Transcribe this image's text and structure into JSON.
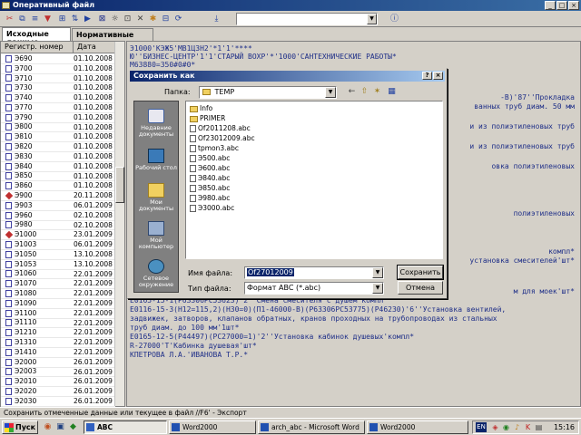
{
  "window": {
    "title": "Оперативный файл"
  },
  "toolbar": {
    "icons": [
      "scissors-icon",
      "copy-icon",
      "equals-icon",
      "filter-icon",
      "insert-icon",
      "sort-icon",
      "play-icon",
      "close-doc-icon",
      "bug-icon",
      "cut-icon",
      "x-icon",
      "star-icon",
      "db-icon",
      "refresh-icon",
      "fetch-icon",
      "info-icon"
    ],
    "combo_value": ""
  },
  "tabs": [
    {
      "label": "Исходные данные",
      "active": true
    },
    {
      "label": "Нормативные данные",
      "active": false
    }
  ],
  "list": {
    "col_reg": "Регистр. номер",
    "col_date": "Дата",
    "rows": [
      {
        "reg": "Э690",
        "date": "01.10.2008"
      },
      {
        "reg": "Э700",
        "date": "01.10.2008"
      },
      {
        "reg": "Э710",
        "date": "01.10.2008"
      },
      {
        "reg": "Э730",
        "date": "01.10.2008"
      },
      {
        "reg": "Э740",
        "date": "01.10.2008"
      },
      {
        "reg": "Э770",
        "date": "01.10.2008"
      },
      {
        "reg": "Э790",
        "date": "01.10.2008"
      },
      {
        "reg": "Э800",
        "date": "01.10.2008"
      },
      {
        "reg": "Э810",
        "date": "01.10.2008"
      },
      {
        "reg": "Э820",
        "date": "01.10.2008"
      },
      {
        "reg": "Э830",
        "date": "01.10.2008"
      },
      {
        "reg": "Э840",
        "date": "01.10.2008"
      },
      {
        "reg": "Э850",
        "date": "01.10.2008"
      },
      {
        "reg": "Э860",
        "date": "01.10.2008"
      },
      {
        "reg": "Э900",
        "date": "20.11.2008",
        "mark": true
      },
      {
        "reg": "Э903",
        "date": "06.01.2009"
      },
      {
        "reg": "Э960",
        "date": "02.10.2008"
      },
      {
        "reg": "Э980",
        "date": "02.10.2008"
      },
      {
        "reg": "Э1000",
        "date": "23.01.2009",
        "mark": true
      },
      {
        "reg": "Э1003",
        "date": "06.01.2009"
      },
      {
        "reg": "Э1050",
        "date": "13.10.2008"
      },
      {
        "reg": "Э1053",
        "date": "13.10.2008"
      },
      {
        "reg": "Э1060",
        "date": "22.01.2009"
      },
      {
        "reg": "Э1070",
        "date": "22.01.2009"
      },
      {
        "reg": "Э1080",
        "date": "22.01.2009"
      },
      {
        "reg": "Э1090",
        "date": "22.01.2009"
      },
      {
        "reg": "Э1100",
        "date": "22.01.2009"
      },
      {
        "reg": "Э1110",
        "date": "22.01.2009"
      },
      {
        "reg": "Э1210",
        "date": "22.01.2009"
      },
      {
        "reg": "Э1310",
        "date": "22.01.2009"
      },
      {
        "reg": "Э1410",
        "date": "22.01.2009"
      },
      {
        "reg": "Э2000",
        "date": "26.01.2009"
      },
      {
        "reg": "Э2003",
        "date": "26.01.2009"
      },
      {
        "reg": "Э2010",
        "date": "26.01.2009"
      },
      {
        "reg": "Э2020",
        "date": "26.01.2009"
      },
      {
        "reg": "Э2030",
        "date": "26.01.2009"
      }
    ]
  },
  "text_pane": {
    "lines": [
      "Э1000'КЭЖ5'МВ1ЦЗН2'*1'1'****",
      "Ю''БИЗНЕС-ЦЕНТР'1'1'СТАРЫЙ ВОХР'*'1000'САНТЕХНИЧЕСКИЕ РАБОТЫ*",
      "М63880=350#0#0*",
      "-В)'87''Прокладка",
      "ванных труб диам. 50 мм",
      "",
      "и из полиэтиленовых труб",
      "",
      "и из полиэтиленовых труб",
      "",
      "овка полиэтиленовых",
      "",
      "",
      "",
      "полиэтиленовых",
      "",
      "",
      "",
      "компл*",
      "установка смесителей'шт*",
      "",
      "",
      "м для моек'шт*",
      "Е0165-15-1(Р63306РС53623)'2''Смена смесителя с душем компл",
      "Е0116-15-3(Н12=115,2)(Н30=0)(П1-46000-В)(Р63306РС53775)(Р46230)'6''Установка вентилей,",
      "задвижек, затворов, клапанов обратных, кранов проходных на трубопроводах из стальных",
      "труб диам. до 100 мм'1шт*",
      "Е0165-12-5(Р44497)(РС27000=1)'2''Установка кабинок душевых'компл*",
      "R-27000'Т'Кабинка душевая'шт*",
      "КПЕТРОВА Л.А.'ИВАНОВА Т.Р.*"
    ]
  },
  "dialog": {
    "title": "Сохранить как",
    "help": "?",
    "close": "×",
    "folder_label": "Папка:",
    "folder_value": "TEMP",
    "places": [
      {
        "label": "Недавние документы",
        "icon": "recent-docs-icon"
      },
      {
        "label": "Рабочий стол",
        "icon": "desktop-icon"
      },
      {
        "label": "Мои документы",
        "icon": "my-documents-icon"
      },
      {
        "label": "Мой компьютер",
        "icon": "my-computer-icon"
      },
      {
        "label": "Сетевое окружение",
        "icon": "network-icon"
      }
    ],
    "files": [
      {
        "name": "Info",
        "kind": "folder"
      },
      {
        "name": "PRIMER",
        "kind": "folder"
      },
      {
        "name": "Of2011208.abc",
        "kind": "file"
      },
      {
        "name": "Of23012009.abc",
        "kind": "file"
      },
      {
        "name": "tpmon3.abc",
        "kind": "file"
      },
      {
        "name": "Э500.abc",
        "kind": "file"
      },
      {
        "name": "Э600.abc",
        "kind": "file"
      },
      {
        "name": "Э840.abc",
        "kind": "file"
      },
      {
        "name": "Э850.abc",
        "kind": "file"
      },
      {
        "name": "Э980.abc",
        "kind": "file"
      },
      {
        "name": "Э3000.abc",
        "kind": "file"
      }
    ],
    "filename_label": "Имя файла:",
    "filename_value": "Of27012009",
    "filetype_label": "Тип файла:",
    "filetype_value": "Формат ABC (*.abc)",
    "save_button": "Сохранить",
    "cancel_button": "Отмена"
  },
  "status": {
    "text": "Сохранить отмеченные данные или текущее в файл  //F6' - Экспорт"
  },
  "taskbar": {
    "start": "Пуск",
    "tasks": [
      {
        "label": "ABC",
        "active": true
      },
      {
        "label": "Word2000",
        "active": false
      },
      {
        "label": "arch_abc - Microsoft Word",
        "active": false
      },
      {
        "label": "Word2000",
        "active": false
      }
    ],
    "lang": "EN",
    "clock": "15:16"
  }
}
